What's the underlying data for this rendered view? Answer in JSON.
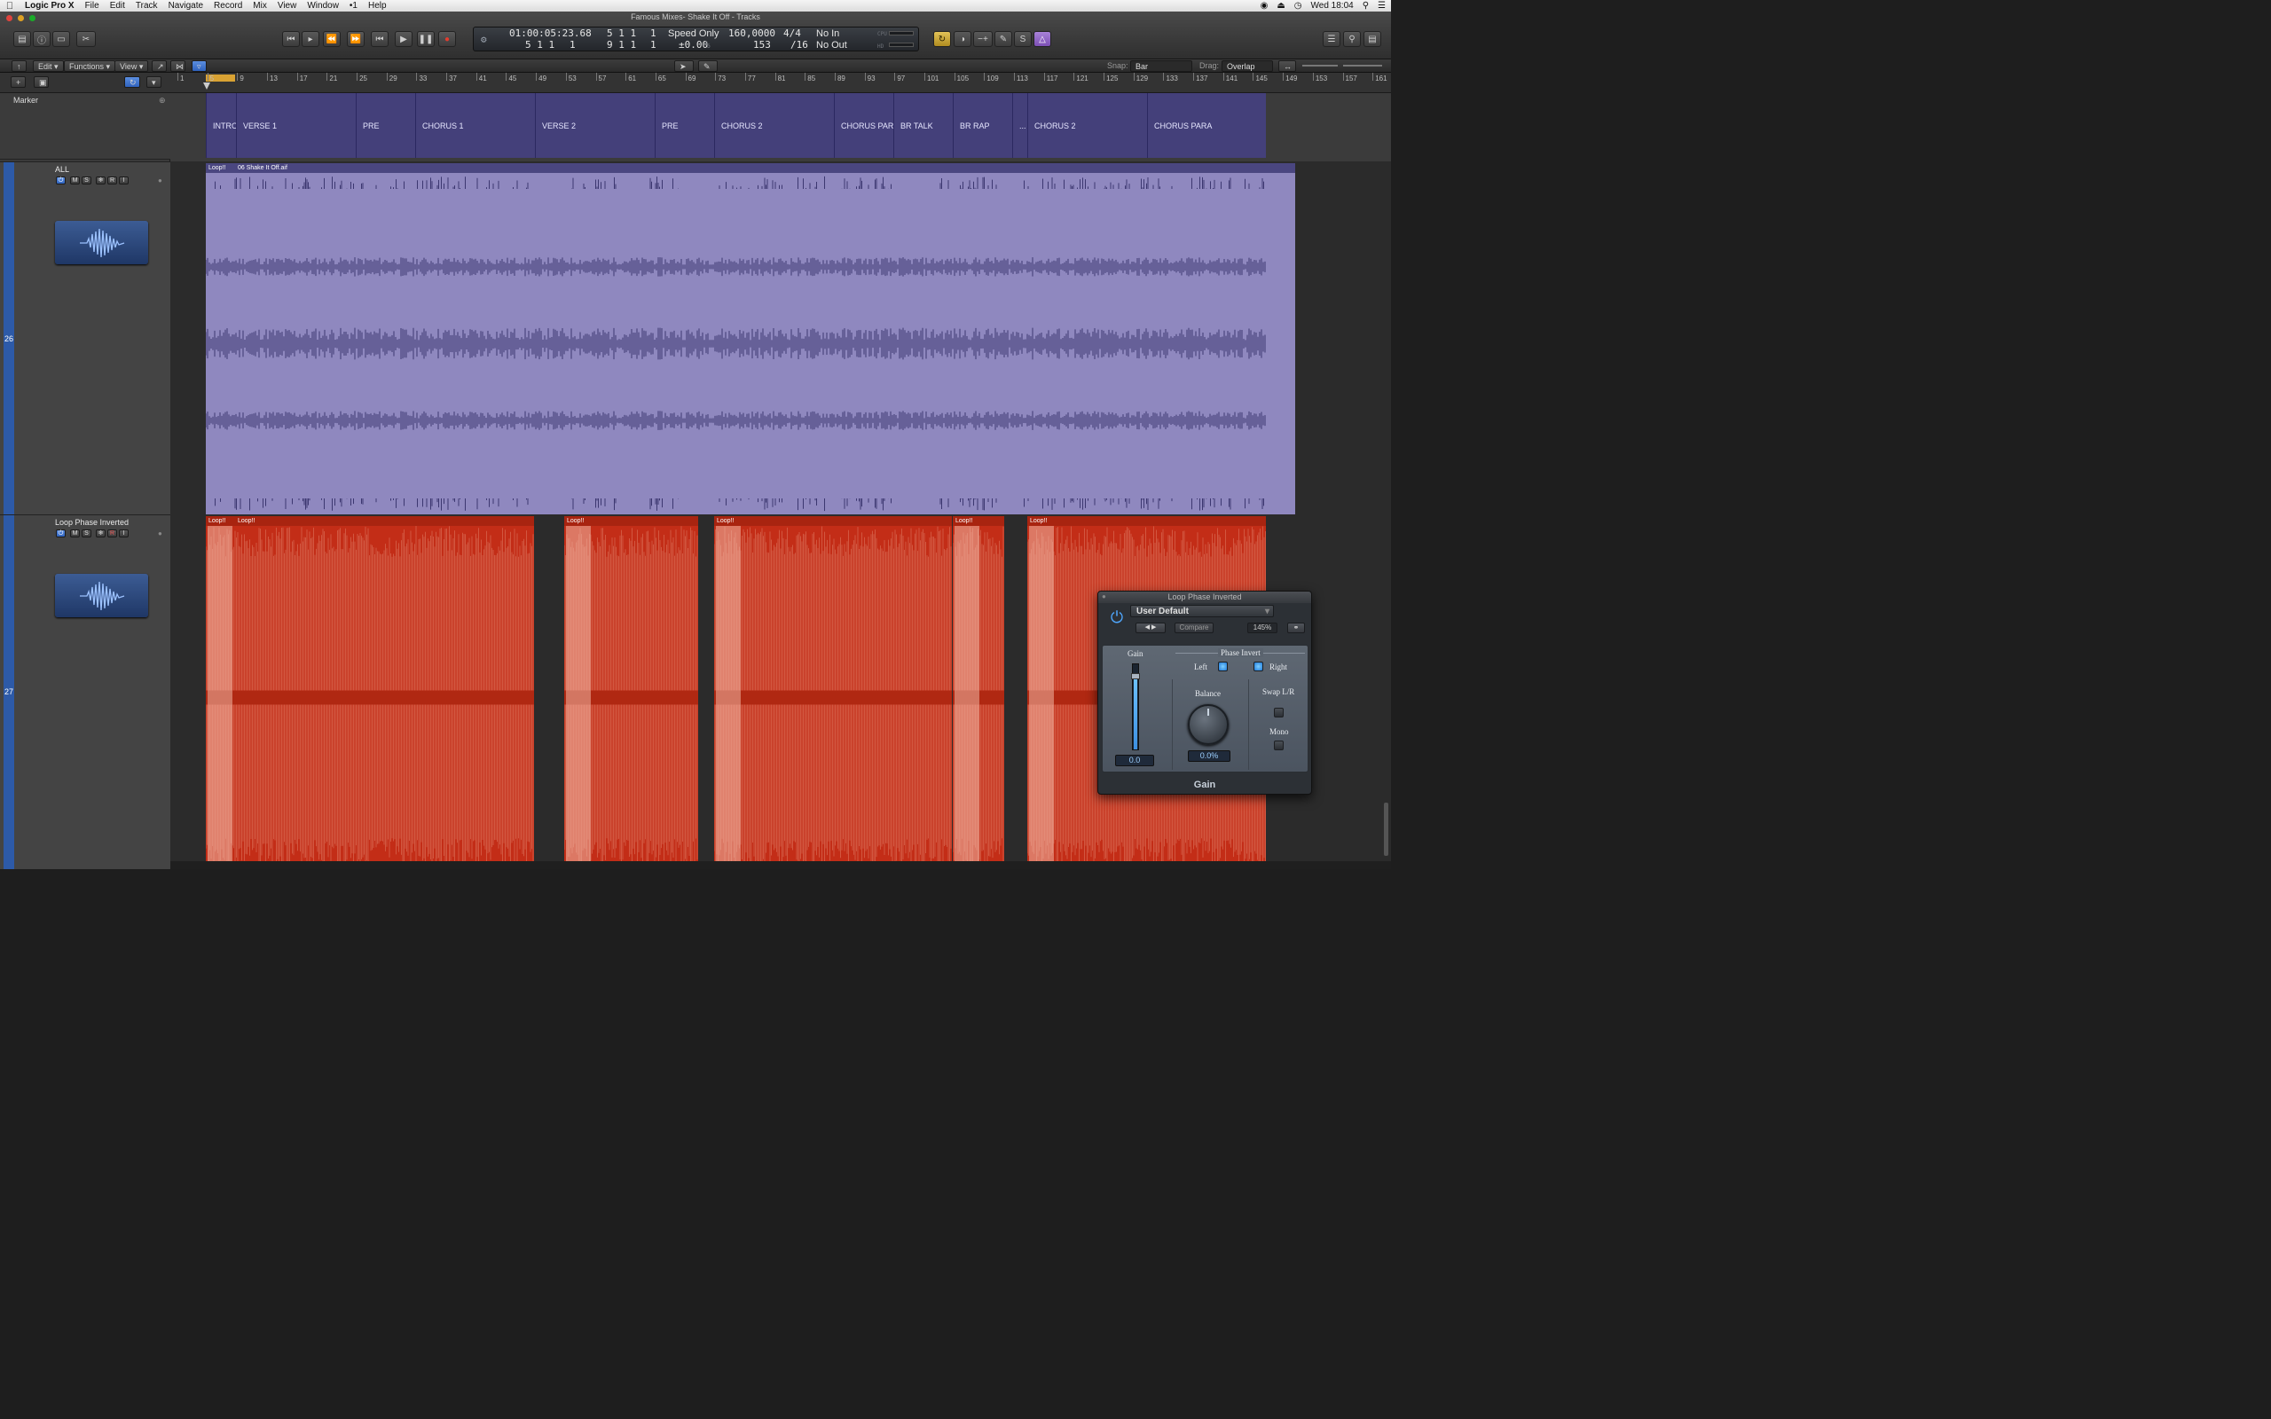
{
  "menubar": {
    "app_name": "Logic Pro X",
    "items": [
      "File",
      "Edit",
      "Track",
      "Navigate",
      "Record",
      "Mix",
      "View",
      "Window",
      "•1",
      "Help"
    ],
    "clock": "Wed 18:04"
  },
  "window": {
    "title": "Famous Mixes- Shake It Off - Tracks"
  },
  "lcd": {
    "smpte": "01:00:05:23.68",
    "bar_pos_1": "5 1 1",
    "tick_1": "1",
    "bar_pos_2": "5 1 1",
    "tick_2": "1",
    "end_pos_1": "5 1 1",
    "end_tick_1": "1",
    "end_pos_2": "9 1 1",
    "end_tick_2": "1",
    "mode": "Speed Only",
    "pitch": "±0.00",
    "pitch_unit": "%",
    "tempo": "160,0000",
    "tempo_sub": "153",
    "signature": "4/4",
    "division": "/16",
    "in": "No In",
    "out": "No Out",
    "cpu": "CPU",
    "hd": "HD"
  },
  "tracks_bar": {
    "edit": "Edit",
    "functions": "Functions",
    "view": "View",
    "snap_label": "Snap:",
    "snap_value": "Bar",
    "drag_label": "Drag:",
    "drag_value": "Overlap"
  },
  "ruler": {
    "bars": [
      "1",
      "5",
      "9",
      "13",
      "17",
      "21",
      "25",
      "29",
      "33",
      "37",
      "41",
      "45",
      "49",
      "53",
      "57",
      "61",
      "65",
      "69",
      "73",
      "77",
      "81",
      "85",
      "89",
      "93",
      "97",
      "101",
      "105",
      "109",
      "113",
      "117",
      "121",
      "125",
      "129",
      "133",
      "137",
      "141",
      "145",
      "149",
      "153",
      "157",
      "161"
    ]
  },
  "marker_track": {
    "label": "Marker",
    "markers": [
      "INTRO",
      "VERSE 1",
      "PRE",
      "CHORUS 1",
      "VERSE 2",
      "PRE",
      "CHORUS 2",
      "CHORUS PARA",
      "BR TALK",
      "BR RAP",
      "...",
      "CHORUS 2",
      "CHORUS PARA"
    ]
  },
  "tracks": [
    {
      "number": "26",
      "name": "ALL",
      "buttons": [
        "⏻",
        "M",
        "S",
        "❄",
        "R",
        "I"
      ],
      "regions": [
        {
          "label": "Loop!!"
        },
        {
          "label": "06 Shake It Off.aif"
        }
      ]
    },
    {
      "number": "27",
      "name": "Loop Phase Inverted",
      "buttons": [
        "⏻",
        "M",
        "S",
        "❄",
        "R",
        "I"
      ],
      "regions": [
        {
          "label": "Loop!!"
        },
        {
          "label": "Loop!!"
        },
        {
          "label": "Loop!!"
        },
        {
          "label": "Loop!!"
        },
        {
          "label": "Loop!!"
        },
        {
          "label": "Loop!!"
        }
      ]
    }
  ],
  "plugin": {
    "title": "Loop Phase Inverted",
    "preset": "User Default",
    "compare": "Compare",
    "zoom": "145%",
    "gain_label": "Gain",
    "gain_value": "0.0",
    "phase_invert_label": "Phase Invert",
    "left_label": "Left",
    "right_label": "Right",
    "left_on": true,
    "right_on": true,
    "balance_label": "Balance",
    "balance_value": "0.0%",
    "swap_label": "Swap L/R",
    "mono_label": "Mono",
    "footer": "Gain"
  },
  "colors": {
    "audio_region": "#8f88bf",
    "phase_region": "#c32d17",
    "marker": "#44407a",
    "track_strip": "#2d5aa8"
  }
}
